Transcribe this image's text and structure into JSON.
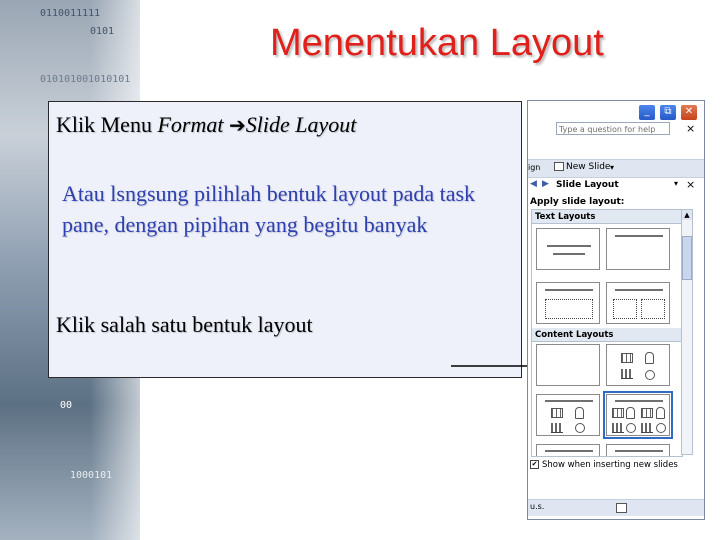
{
  "slide": {
    "title": "Menentukan Layout",
    "menu_line": {
      "prefix": "Klik Menu  ",
      "format": "Format",
      "arrow": "➔",
      "slide_layout": "Slide Layout"
    },
    "paragraph": "Atau lsngsung pilihlah bentuk layout pada task pane, dengan pipihan yang begitu banyak",
    "click_instruction": "Klik salah satu bentuk layout"
  },
  "background_binary": {
    "row1": "0110011111",
    "row2": "0101",
    "row3": "010101001010101",
    "row4": "00",
    "row5": "1000101"
  },
  "task_pane": {
    "help_placeholder": "Type a question for help",
    "window_buttons": {
      "minimize": "_",
      "restore": "⧉",
      "close": "✕"
    },
    "help_close": "×",
    "toolbar": {
      "edge": "ign",
      "new_slide": "New Slide",
      "dropdown": "▾"
    },
    "nav": {
      "back": "◀",
      "forward": "▶",
      "title": "Slide Layout",
      "dropdown": "▾",
      "close": "×"
    },
    "apply_label": "Apply slide layout:",
    "sections": {
      "text_layouts": "Text Layouts",
      "content_layouts": "Content Layouts"
    },
    "scroll_up": "▲",
    "show_checkbox": {
      "label": "Show when inserting new slides",
      "checked": true,
      "mark": "✔"
    },
    "footer": {
      "text": "u.s."
    }
  },
  "colors": {
    "title": "#e0201b",
    "paragraph": "#2e3fae",
    "content_box_bg": "#eef1fa"
  }
}
